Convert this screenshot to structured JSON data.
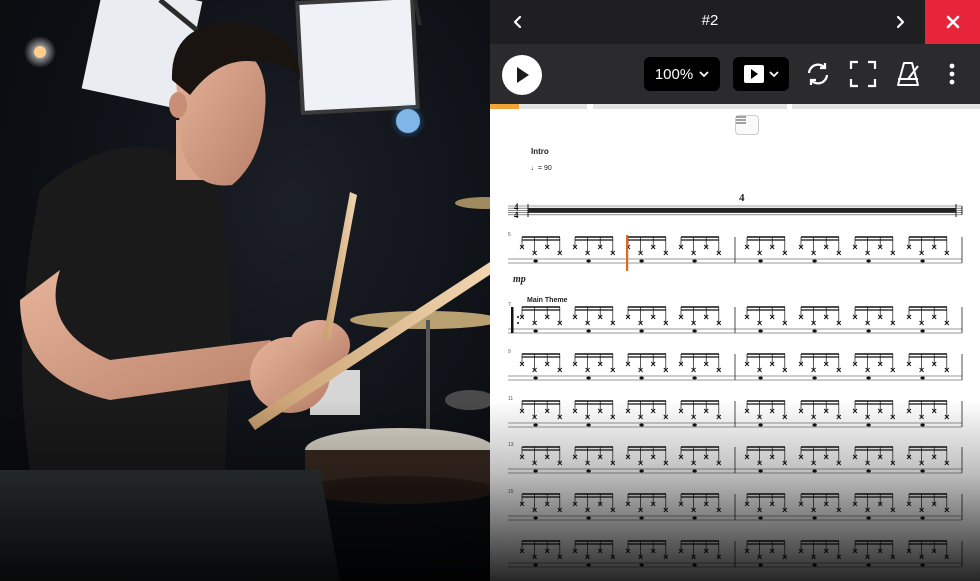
{
  "viewer": {
    "title": "#2",
    "zoom_value": "100%",
    "icons": {
      "prev": "chevron-left-icon",
      "next": "chevron-right-icon",
      "close": "close-icon",
      "play": "play-icon",
      "playback_mode": "play-square-icon",
      "loop": "loop-icon",
      "fullscreen": "fullscreen-icon",
      "metronome": "metronome-icon",
      "more": "more-vertical-icon",
      "collapse": "menu-icon"
    },
    "colors": {
      "close_bg": "#e8243a",
      "progress_fill": "#f2a33a",
      "cursor": "#e06a1b",
      "toolbar_bg": "#2b2b2e",
      "titlebar_bg": "#1f1f22"
    },
    "progress": {
      "segments": [
        {
          "fill_fraction": 0.3
        },
        {
          "fill_fraction": 0
        },
        {
          "fill_fraction": 0
        }
      ]
    }
  },
  "sheet": {
    "intro_label": "Intro",
    "tempo_text": "= 90",
    "time_signature": {
      "top": "4",
      "bottom": "4"
    },
    "multirest_count": "4",
    "dynamic": "mp",
    "main_theme_label": "Main Theme",
    "system_numbers": [
      "5",
      "7",
      "9",
      "11",
      "13",
      "15"
    ]
  }
}
